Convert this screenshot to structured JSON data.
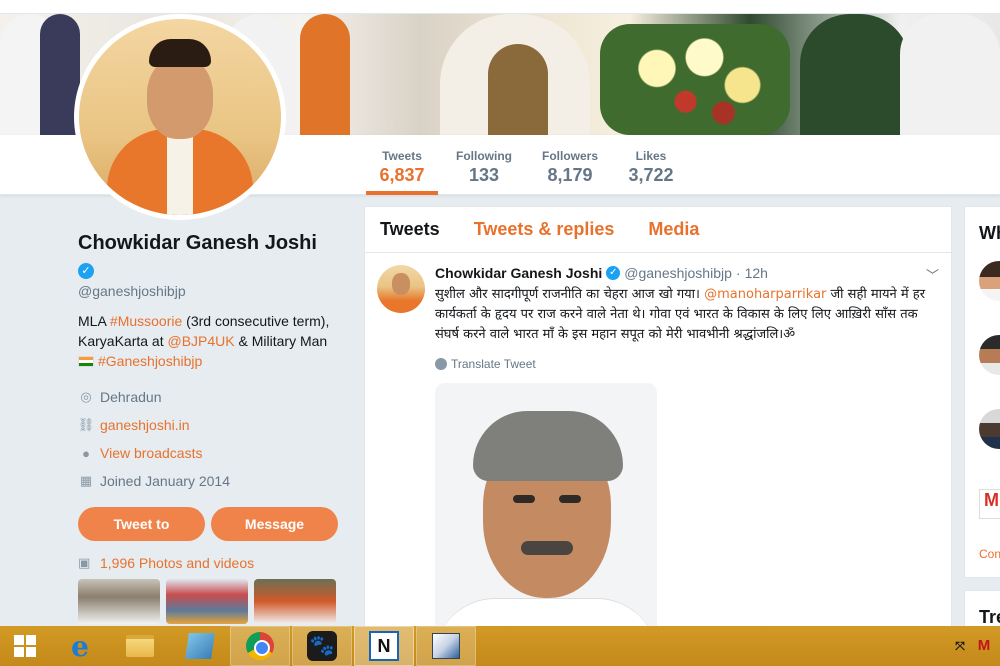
{
  "profile": {
    "name": "Chowkidar Ganesh Joshi",
    "handle": "@ganeshjoshibjp",
    "bio": {
      "line1_pre": "MLA ",
      "hashtag1": "#Mussoorie",
      "line1_post": " (3rd consecutive term),",
      "line2_pre": "KaryaKarta at ",
      "mention1": "@BJP4UK",
      "line2_post": " & Military Man",
      "hashtag2": "#Ganeshjoshibjp"
    },
    "location": "Dehradun",
    "website": "ganeshjoshi.in",
    "broadcasts": "View broadcasts",
    "joined": "Joined January 2014",
    "tweet_to_label": "Tweet to",
    "message_label": "Message",
    "photos_link": "1,996 Photos and videos"
  },
  "stats": {
    "tweets_label": "Tweets",
    "tweets_value": "6,837",
    "following_label": "Following",
    "following_value": "133",
    "followers_label": "Followers",
    "followers_value": "8,179",
    "likes_label": "Likes",
    "likes_value": "3,722"
  },
  "timeline": {
    "tabs": [
      "Tweets",
      "Tweets & replies",
      "Media"
    ],
    "tweet": {
      "name": "Chowkidar Ganesh Joshi",
      "handle": "@ganeshjoshibjp",
      "dot": "·",
      "time": "12h",
      "text_pre": "सुशील और सादगीपूर्ण राजनीति का चेहरा आज खो गया। ",
      "mention": "@manoharparrikar",
      "text_post": " जी सही मायने में हर कार्यकर्ता के हृदय पर राज करने वाले नेता थे। गोवा एवं भारत के विकास के लिए लिए आख़िरी साँस तक संघर्ष करने वाले भारत माँ के इस महान सपूत को मेरी भावभीनी श्रद्धांजलि।ॐ",
      "translate": "Translate Tweet"
    }
  },
  "right_column": {
    "header_partial": "Wh",
    "gmail_partial": "M",
    "link_partial": "Con",
    "trends_partial": "Tre"
  },
  "colors": {
    "accent": "#e8722d",
    "button": "#f0834a",
    "verified": "#1da1f2",
    "taskbar": "#c98e1d"
  },
  "taskbar": {
    "items": [
      "start",
      "internet-explorer",
      "file-explorer",
      "notepad",
      "chrome",
      "paw-app",
      "n-app",
      "paint"
    ],
    "tray_icons": [
      "network-icon",
      "mcafee-icon"
    ]
  }
}
